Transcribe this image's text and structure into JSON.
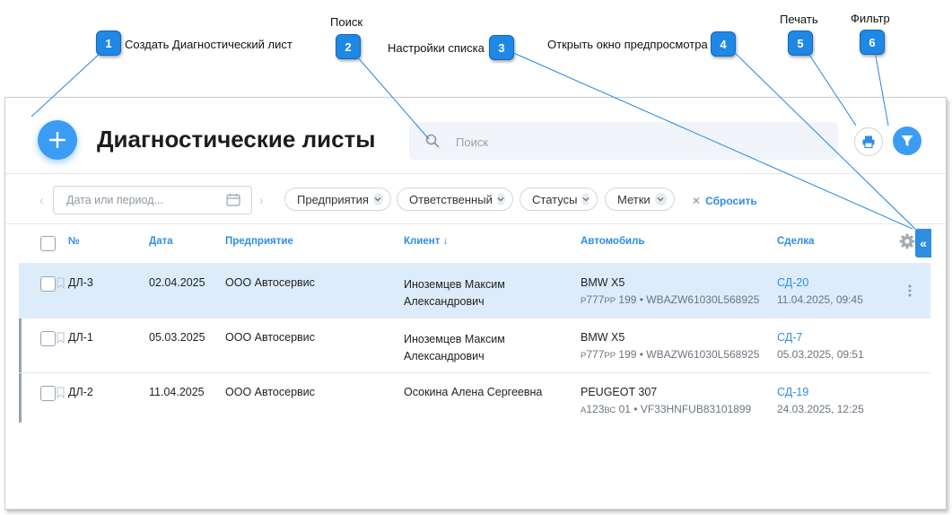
{
  "callouts": [
    {
      "num": "1",
      "label": "Создать Диагностический лист"
    },
    {
      "num": "2",
      "label": "Поиск"
    },
    {
      "num": "3",
      "label": "Настройки списка"
    },
    {
      "num": "4",
      "label": "Открыть окно предпросмотра"
    },
    {
      "num": "5",
      "label": "Печать"
    },
    {
      "num": "6",
      "label": "Фильтр"
    }
  ],
  "header": {
    "title": "Диагностические листы",
    "search_placeholder": "Поиск"
  },
  "filters": {
    "date_placeholder": "Дата или период...",
    "chips": [
      "Предприятия",
      "Ответственный",
      "Статусы",
      "Метки"
    ],
    "reset_label": "Сбросить"
  },
  "table": {
    "columns": [
      "№",
      "Дата",
      "Предприятие",
      "Клиент ↓",
      "Автомобиль",
      "Сделка"
    ],
    "rows": [
      {
        "num": "ДЛ-3",
        "date": "02.04.2025",
        "company": "ООО Автосервис",
        "client_line1": "Иноземцев Максим",
        "client_line2": "Александрович",
        "car": "BMW X5",
        "plate_a": "Р",
        "plate_b": "777",
        "plate_c": "РР",
        "plate_rest": "199 • WBAZW61030L568925",
        "deal": "СД-20",
        "deal_date": "11.04.2025, 09:45",
        "selected": true
      },
      {
        "num": "ДЛ-1",
        "date": "05.03.2025",
        "company": "ООО Автосервис",
        "client_line1": "Иноземцев Максим",
        "client_line2": "Александрович",
        "car": "BMW X5",
        "plate_a": "Р",
        "plate_b": "777",
        "plate_c": "РР",
        "plate_rest": "199 • WBAZW61030L568925",
        "deal": "СД-7",
        "deal_date": "05.03.2025, 09:51",
        "selected": false
      },
      {
        "num": "ДЛ-2",
        "date": "11.04.2025",
        "company": "ООО Автосервис",
        "client_line1": "Осокина Алена Сергеевна",
        "client_line2": "",
        "car": "PEUGEOT 307",
        "plate_a": "А",
        "plate_b": "123",
        "plate_c": "ВС",
        "plate_rest": "01 • VF33HNFUB83101899",
        "deal": "СД-19",
        "deal_date": "24.03.2025, 12:25",
        "selected": false
      }
    ]
  },
  "colors": {
    "accent": "#3b9cf5",
    "callout": "#1e88e5",
    "selected_row": "#dcecfb"
  },
  "icons": {
    "add": "plus-icon",
    "search": "search-icon",
    "print": "printer-icon",
    "filter": "funnel-icon",
    "settings": "gear-icon",
    "collapse": "double-chevron-left-icon",
    "more": "kebab-icon",
    "calendar": "calendar-icon",
    "bookmark": "bookmark-icon"
  }
}
